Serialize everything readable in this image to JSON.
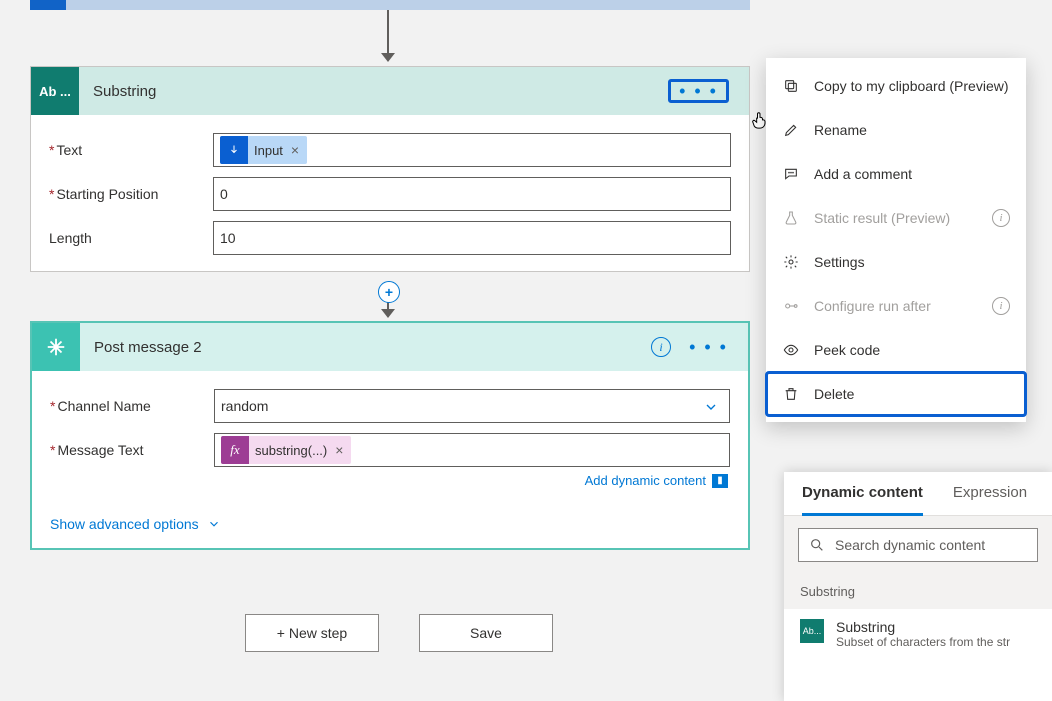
{
  "cards": {
    "substring": {
      "iconText": "Ab ...",
      "title": "Substring",
      "fields": {
        "text": {
          "label": "Text",
          "tokenLabel": "Input"
        },
        "start": {
          "label": "Starting Position",
          "value": "0"
        },
        "length": {
          "label": "Length",
          "value": "10"
        }
      }
    },
    "postMessage": {
      "title": "Post message 2",
      "fields": {
        "channel": {
          "label": "Channel Name",
          "value": "random"
        },
        "message": {
          "label": "Message Text",
          "tokenLabel": "substring(...)",
          "tokenIcon": "fx"
        }
      },
      "addDynamic": "Add dynamic content",
      "showAdvanced": "Show advanced options"
    }
  },
  "footer": {
    "newStep": "+ New step",
    "save": "Save"
  },
  "contextMenu": {
    "copy": "Copy to my clipboard (Preview)",
    "rename": "Rename",
    "comment": "Add a comment",
    "staticResult": "Static result (Preview)",
    "settings": "Settings",
    "configureRunAfter": "Configure run after",
    "peekCode": "Peek code",
    "delete": "Delete"
  },
  "dcPanel": {
    "tabDynamic": "Dynamic content",
    "tabExpression": "Expression",
    "searchPlaceholder": "Search dynamic content",
    "groupLabel": "Substring",
    "item": {
      "iconText": "Ab...",
      "title": "Substring",
      "subtitle": "Subset of characters from the str"
    }
  }
}
